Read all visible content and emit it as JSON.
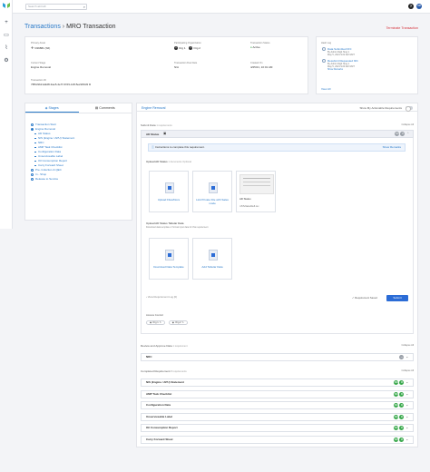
{
  "search": {
    "placeholder": "Search aircraft"
  },
  "user": {
    "initials": "AD"
  },
  "page": {
    "breadcrumb_root": "Transactions",
    "separator": "›",
    "title": "MRO Transaction",
    "terminate_label": "Terminate Transaction"
  },
  "summary": {
    "primary_asset_label": "Primary Asset",
    "primary_asset_value": "N39881 (S6)",
    "participants_label": "Participating Organization",
    "participants": [
      {
        "initials": "O",
        "name": "Org 1"
      },
      {
        "initials": "O",
        "name": "Org 2"
      }
    ],
    "status_label": "Transaction Status",
    "status_value": "Active",
    "stage_label": "Current Stage",
    "stage_value": "Engine Removal",
    "due_label": "Transaction Due Date",
    "due_value": "N/A",
    "created_label": "Created On",
    "created_value": "4/25/21, 10:01 AM",
    "id_label": "Transaction ID",
    "id_value": "7f89c9b21a9d8-3ae5-4e7f-97d9-14f15e2209d3"
  },
  "history": {
    "title": "Hash Log",
    "items": [
      {
        "title": "Data Submitted",
        "tag": "NFC",
        "who": "By Admin Digit Sing 1",
        "when": "May 5, 2021 9:22 AM GMT"
      },
      {
        "title": "Resubmit Requested",
        "tag": "NFC",
        "who": "By Admin Digit Sing 1",
        "when": "May 5, 2021 9:20 AM GMT"
      }
    ],
    "show_details": "Show Remarks",
    "view_all": "View All"
  },
  "left_tabs": {
    "stages": "Stages",
    "comments": "Comments"
  },
  "stages": [
    {
      "label": "Transaction Start",
      "kind": "main"
    },
    {
      "label": "Engine Removal",
      "kind": "main-active"
    },
    {
      "label": "AD Status",
      "kind": "sub"
    },
    {
      "label": "NIS (Engine / APU) Statement",
      "kind": "sub"
    },
    {
      "label": "NRC",
      "kind": "sub"
    },
    {
      "label": "AMP Task Checklist",
      "kind": "sub"
    },
    {
      "label": "Configuration Data",
      "kind": "sub"
    },
    {
      "label": "Unserviceable Label",
      "kind": "sub"
    },
    {
      "label": "Oil Consumption Report",
      "kind": "sub"
    },
    {
      "label": "Carry Forward Sheet",
      "kind": "sub"
    },
    {
      "label": "Pre- Induction & QEC",
      "kind": "main"
    },
    {
      "label": "In - Shop",
      "kind": "main"
    },
    {
      "label": "Release to Service",
      "kind": "main"
    }
  ],
  "main": {
    "section_title": "Engine Removal",
    "toggle_label": "Show My Actionable Requirements",
    "submit_data_label": "Submit Data",
    "submit_data_count": "1 requirements",
    "collapse_all": "Collapse All",
    "ad_status_title": "AD Status",
    "instruction_text": "Instructions to complete this requirement.",
    "show_remarks": "Show Remarks",
    "upload_title": "Upload AD Status",
    "upload_count": "1 documents",
    "upload_optional": "Optional",
    "upload_cards": [
      {
        "caption": "Upload Files/Docs"
      },
      {
        "caption": "Link Private File with Sales mode"
      }
    ],
    "doc_preview_caption": "AD Status",
    "doc_preview_file": "n7b5c9a4eb9e8.csv",
    "tabular_title": "Upload AD Status Tabular Data",
    "tabular_desc": "Download data template or format input data for this requirement",
    "tabular_cards": [
      {
        "caption": "Download Data Template"
      },
      {
        "caption": "Add Tabular Data"
      }
    ],
    "view_log": "View Requirement Log (0)",
    "requirement_saved": "Requirement Saved",
    "submit_button": "Submit",
    "access_control_label": "Access Control",
    "access_pills": [
      "Org 1",
      "Org 2"
    ],
    "review_label": "Review and Approve Data",
    "review_count": "1 requirement",
    "review_item": "NRC",
    "completed_label": "Completed Requirement",
    "completed_count": "8 requirements",
    "completed_items": [
      "NIS (Engine / APU) Statement",
      "AMP Task Checklist",
      "Configuration Data",
      "Unserviceable Label",
      "Oil Consumption Report",
      "Carry Forward Sheet"
    ]
  }
}
